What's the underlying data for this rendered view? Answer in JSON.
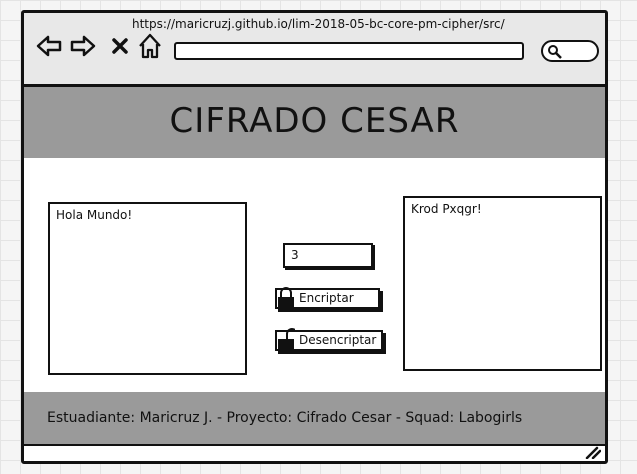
{
  "browser": {
    "url": "https://maricruzj.github.io/lim-2018-05-bc-core-pm-cipher/src/",
    "address_value": ""
  },
  "header": {
    "title": "CIFRADO CESAR"
  },
  "main": {
    "input_text": "Hola Mundo!",
    "shift_value": "3",
    "encrypt_label": "Encriptar",
    "decrypt_label": "Desencriptar",
    "output_text": "Krod Pxqgr!"
  },
  "footer": {
    "text": "Estuadiante: Maricruz J. - Proyecto: Cifrado Cesar - Squad: Labogirls"
  },
  "icons": [
    "back-icon",
    "forward-icon",
    "close-icon",
    "home-icon",
    "search-icon",
    "lock-icon",
    "resize-handle-icon"
  ],
  "colors": {
    "header_bg": "#9a9a9a",
    "browser_bg": "#e8e8e8",
    "stroke": "#111111"
  }
}
